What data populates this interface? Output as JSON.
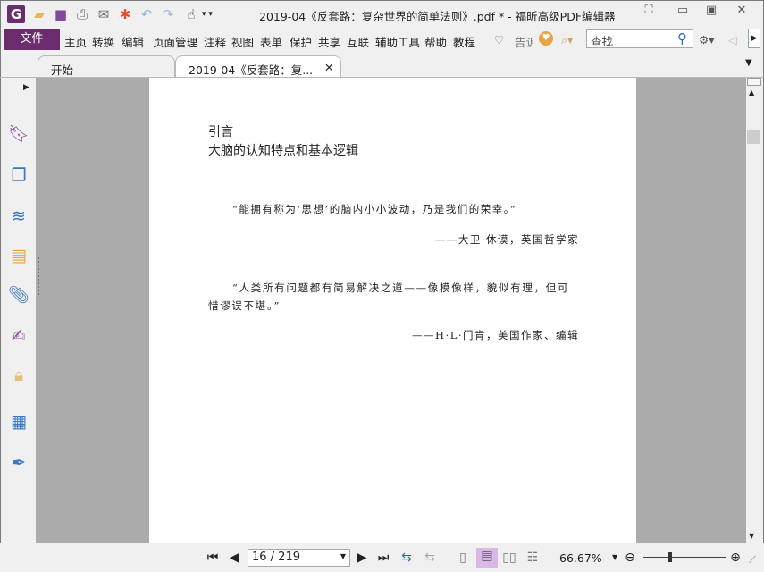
{
  "window": {
    "title": "2019-04《反套路：复杂世界的简单法则》.pdf * - 福昕高级PDF编辑器"
  },
  "menu": {
    "file": "文件",
    "items": [
      "主页",
      "转换",
      "编辑",
      "页面管理",
      "注释",
      "视图",
      "表单",
      "保护",
      "共享",
      "互联",
      "辅助工具",
      "帮助",
      "教程"
    ],
    "tell": "告诉",
    "search_placeholder": "查找"
  },
  "tabs": [
    {
      "label": "开始"
    },
    {
      "label": "2019-04《反套路：复..."
    }
  ],
  "page": {
    "heading1": "引言",
    "heading2": "大脑的认知特点和基本逻辑",
    "quote1": "“能拥有称为‘思想’的脑内小小波动，乃是我们的荣幸。”",
    "attr1": "——大卫·休谟，英国哲学家",
    "quote2_line1": "“人类所有问题都有简易解决之道——像模像样，貌似有理，但可",
    "quote2_line2": "惜谬误不堪。”",
    "attr2": "——H·L·门肯，美国作家、编辑"
  },
  "status": {
    "page": "16 / 219",
    "zoom": "66.67%",
    "zoom_slider_fraction": 0.33
  },
  "colors": {
    "accent": "#6b2d6e",
    "doc_bg": "#ababab"
  }
}
